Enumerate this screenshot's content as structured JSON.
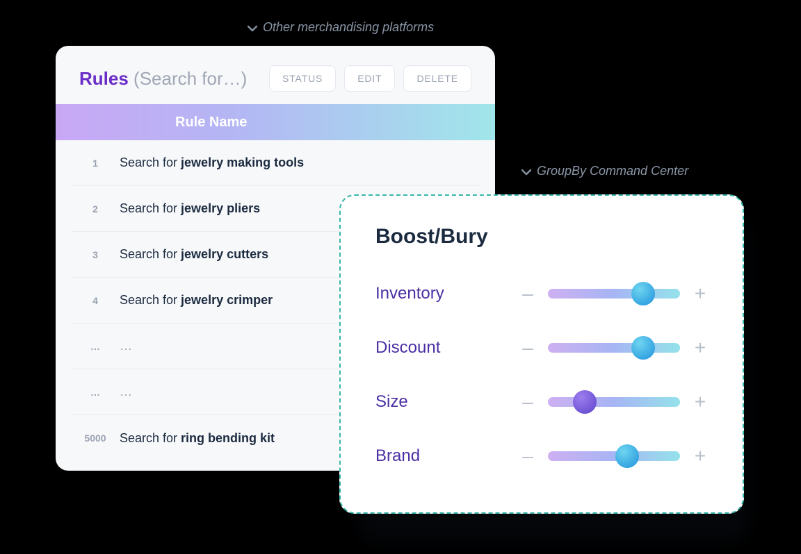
{
  "captions": {
    "other": "Other merchandising platforms",
    "groupby": "GroupBy Command Center"
  },
  "rules": {
    "title_strong": "Rules",
    "title_paren": "(Search for…)",
    "buttons": {
      "status": "STATUS",
      "edit": "EDIT",
      "delete": "DELETE"
    },
    "column": "Rule Name",
    "search_prefix": "Search for ",
    "ellipsis": "…",
    "rows": [
      {
        "num": "1",
        "type": "search",
        "term": "jewelry making tools"
      },
      {
        "num": "2",
        "type": "search",
        "term": "jewelry pliers"
      },
      {
        "num": "3",
        "type": "search",
        "term": "jewelry cutters"
      },
      {
        "num": "4",
        "type": "search",
        "term": "jewelry crimper"
      },
      {
        "num": "…",
        "type": "ellipsis"
      },
      {
        "num": "…",
        "type": "ellipsis"
      },
      {
        "num": "5000",
        "type": "search",
        "term": "ring bending kit"
      }
    ]
  },
  "boost": {
    "title": "Boost/Bury",
    "minus": "–",
    "plus": "+",
    "sliders": [
      {
        "label": "Inventory",
        "pos": 0.72,
        "thumb": "blue"
      },
      {
        "label": "Discount",
        "pos": 0.72,
        "thumb": "blue"
      },
      {
        "label": "Size",
        "pos": 0.28,
        "thumb": "purple"
      },
      {
        "label": "Brand",
        "pos": 0.6,
        "thumb": "blue"
      }
    ]
  }
}
